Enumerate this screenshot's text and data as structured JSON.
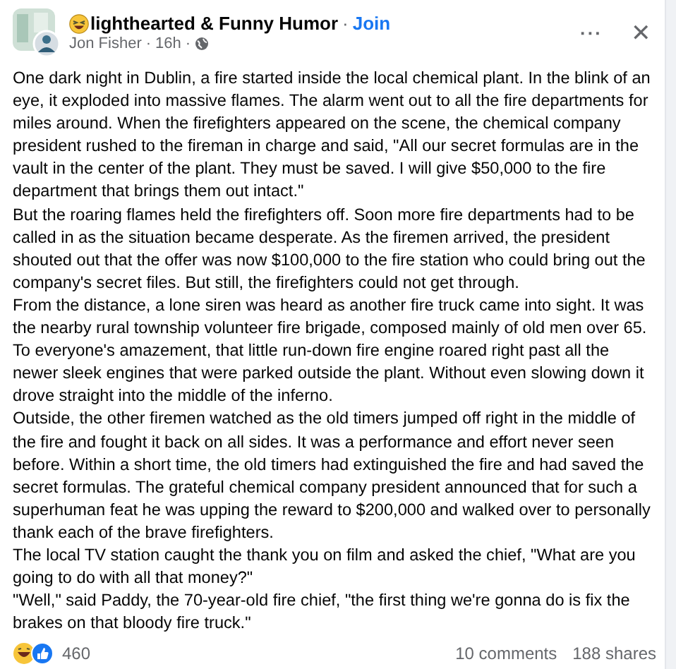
{
  "post": {
    "group_name": "lighthearted & Funny Humor",
    "join_label": "Join",
    "author": "Jon Fisher",
    "separator": "·",
    "time": "16h",
    "separator_2": "·"
  },
  "menu_label": "···",
  "close_label": "✕",
  "paragraphs": [
    "One dark night in Dublin, a fire started inside the local chemical plant. In the blink of an eye, it exploded into massive flames. The alarm went out to all the fire departments for miles around. When the firefighters appeared on the scene, the chemical company president rushed to the fireman in charge and said, \"All our secret formulas are in the vault in the center of the plant. They must be saved. I will give $50,000 to the fire department that brings them out intact.\"",
    "But the roaring flames held the firefighters off. Soon more fire departments had to be called in as the situation became desperate. As the firemen arrived, the president shouted out that the offer was now $100,000 to the fire station who could bring out the company's secret files. But still, the firefighters could not get through.",
    "From the distance, a lone siren was heard as another fire truck came into sight. It was the nearby rural township volunteer fire brigade, composed mainly of old men over 65. To everyone's amazement, that little run-down fire engine roared right past all the newer sleek engines that were parked outside the plant. Without even slowing down it drove straight into the middle of the inferno.",
    "Outside, the other firemen watched as the old timers jumped off right in the middle of the fire and fought it back on all sides. It was a performance and effort never seen before. Within a short time, the old timers had extinguished the fire and had saved the secret formulas. The grateful chemical company president announced that for such a superhuman feat he was upping the reward to $200,000  and walked over to personally thank each of the brave firefighters.",
    "The local TV station caught the thank you on film and asked the chief, \"What are you going to do with all that money?\"",
    "\"Well,\" said Paddy, the 70-year-old fire chief, \"the first thing we're gonna do is fix the brakes on that bloody fire truck.\""
  ],
  "footer": {
    "reaction_count": "460",
    "comments": "10 comments",
    "shares": "188 shares"
  }
}
